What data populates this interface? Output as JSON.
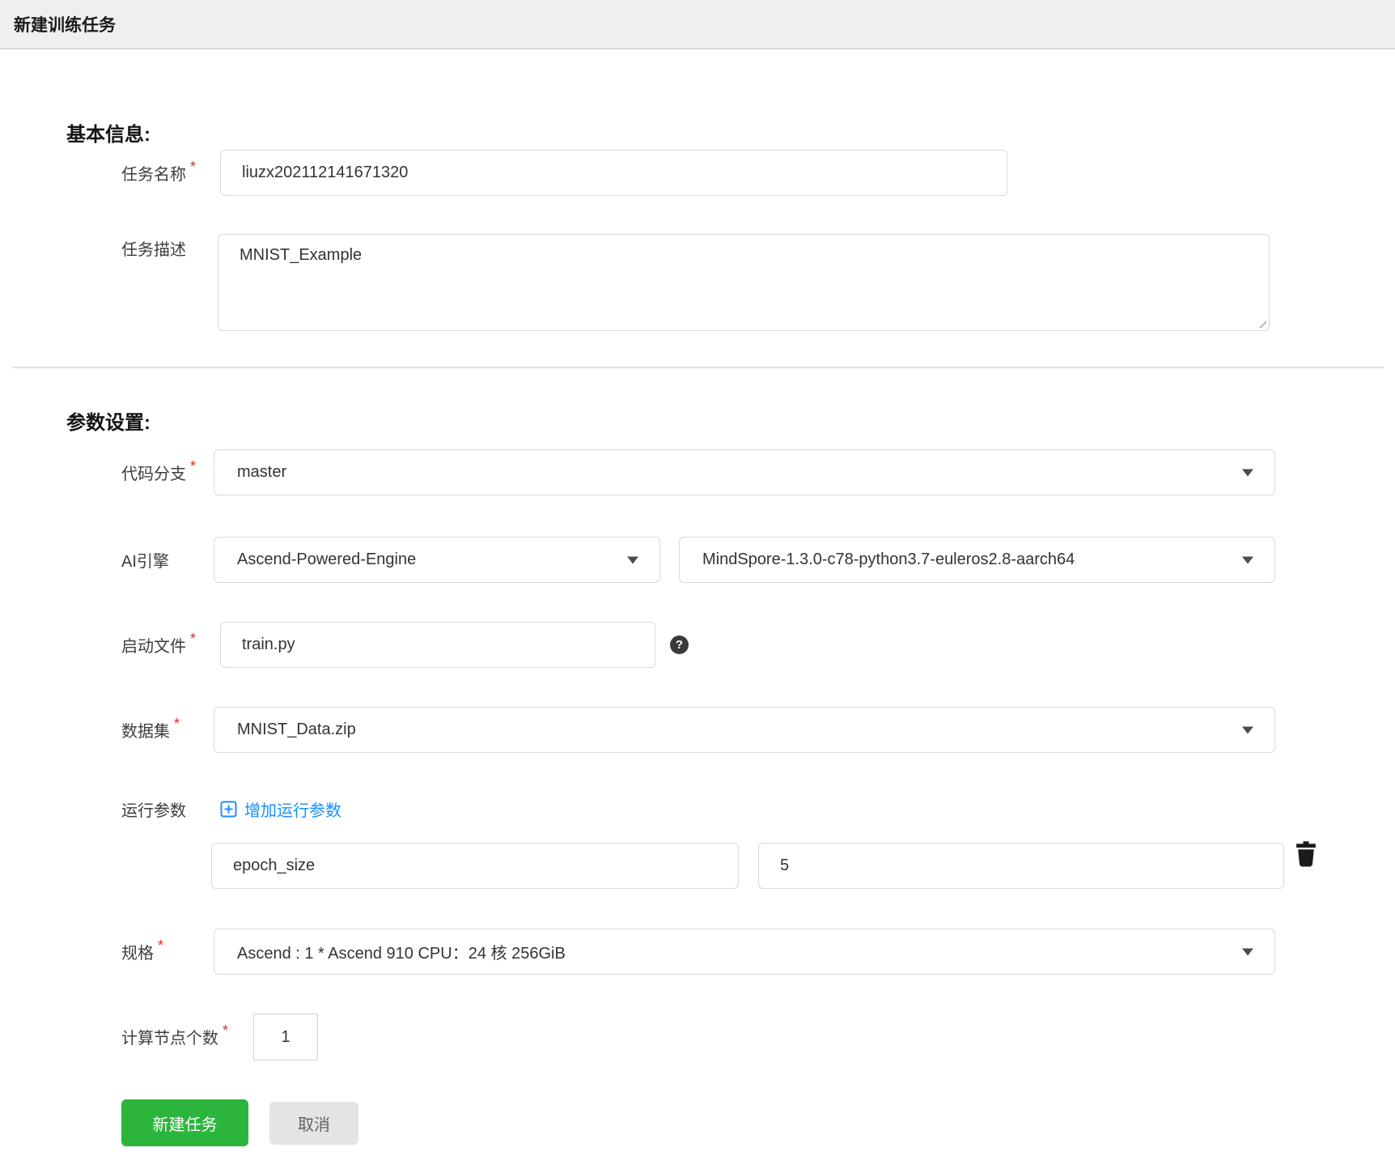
{
  "topbar": {
    "title": "新建训练任务"
  },
  "symbols": {
    "required_mark": "*",
    "help_mark": "?"
  },
  "colors": {
    "topbar_bg": "#efefef",
    "primary_green": "#2bb53c",
    "link_blue": "#1890ff",
    "required_red": "#dd2b22",
    "input_border": "#d9d9d9"
  },
  "sections": {
    "basic": {
      "heading": "基本信息:",
      "fields": {
        "task_name": {
          "label": "任务名称",
          "required": true,
          "value": "liuzx202112141671320"
        },
        "task_desc": {
          "label": "任务描述",
          "required": false,
          "value": "MNIST_Example"
        }
      }
    },
    "params": {
      "heading": "参数设置:",
      "fields": {
        "code_branch": {
          "label": "代码分支",
          "required": true,
          "value": "master"
        },
        "ai_engine": {
          "label": "AI引擎",
          "engine": "Ascend-Powered-Engine",
          "version": "MindSpore-1.3.0-c78-python3.7-euleros2.8-aarch64"
        },
        "boot_file": {
          "label": "启动文件",
          "required": true,
          "value": "train.py"
        },
        "dataset": {
          "label": "数据集",
          "required": true,
          "value": "MNIST_Data.zip"
        },
        "run_params": {
          "label": "运行参数",
          "add_label": "增加运行参数",
          "rows": [
            {
              "key": "epoch_size",
              "value": "5"
            }
          ]
        },
        "spec": {
          "label": "规格",
          "required": true,
          "value": "Ascend : 1 * Ascend 910 CPU：24 核 256GiB"
        },
        "node_count": {
          "label": "计算节点个数",
          "required": true,
          "value": "1"
        }
      }
    }
  },
  "actions": {
    "submit_label": "新建任务",
    "cancel_label": "取消"
  }
}
